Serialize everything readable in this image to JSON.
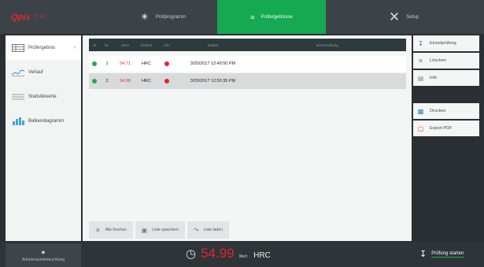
{
  "app": {
    "logo": "Qpix",
    "logo_sub": "T1 /E"
  },
  "nav": {
    "tabs": [
      {
        "label": "Prüfprogramm",
        "icon": "ruler-icon"
      },
      {
        "label": "Prüfergebnisse",
        "icon": "list-icon"
      },
      {
        "label": "Setup",
        "icon": "tools-icon"
      }
    ],
    "active": "Prüfergebnisse"
  },
  "sidebar": {
    "items": [
      {
        "label": "Prüfergebnis",
        "icon": "table-icon"
      },
      {
        "label": "Verlauf",
        "icon": "line-chart-icon"
      },
      {
        "label": "Statistikwerte",
        "icon": "stats-icon"
      },
      {
        "label": "Balkendiagramm",
        "icon": "bar-chart-icon"
      }
    ]
  },
  "table": {
    "headers": [
      "St",
      "Nr.",
      "Wert",
      "Einheit",
      "Info",
      "Datum",
      "Beschreibung"
    ],
    "rows": [
      {
        "status": "ok",
        "nr": "1",
        "wert": "54.71",
        "einheit": "HRC",
        "info": "warning",
        "datum": "3/20/2017 12:49:50 PM",
        "beschreibung": ""
      },
      {
        "status": "ok",
        "nr": "2",
        "wert": "54.99",
        "einheit": "HRC",
        "info": "warning",
        "datum": "3/20/2017 12:50:35 PM",
        "beschreibung": ""
      }
    ]
  },
  "bottom_buttons": [
    {
      "label": "Alle löschen",
      "icon": "x-icon"
    },
    {
      "label": "Liste speichern",
      "icon": "save-list-icon"
    },
    {
      "label": "Liste laden",
      "icon": "load-list-icon"
    }
  ],
  "right_panel": {
    "buttons": [
      {
        "label": "Einzelprüfung",
        "icon": "probe-icon"
      },
      {
        "label": "Löschen",
        "icon": "x-icon"
      },
      {
        "label": "Info",
        "icon": "info-icon"
      },
      {
        "label": "Drucken",
        "icon": "printer-icon"
      },
      {
        "label": "Export PDF",
        "icon": "pdf-icon"
      }
    ]
  },
  "footer": {
    "workspace_label": "Arbeitsraumbeleuchtung",
    "reading_value": "54.99",
    "reading_label": "Wert",
    "reading_unit": "HRC",
    "start_label": "Prüfung starten"
  },
  "colors": {
    "accent": "#17a854",
    "value_red": "#e2262b",
    "topbar": "#3b4348"
  }
}
